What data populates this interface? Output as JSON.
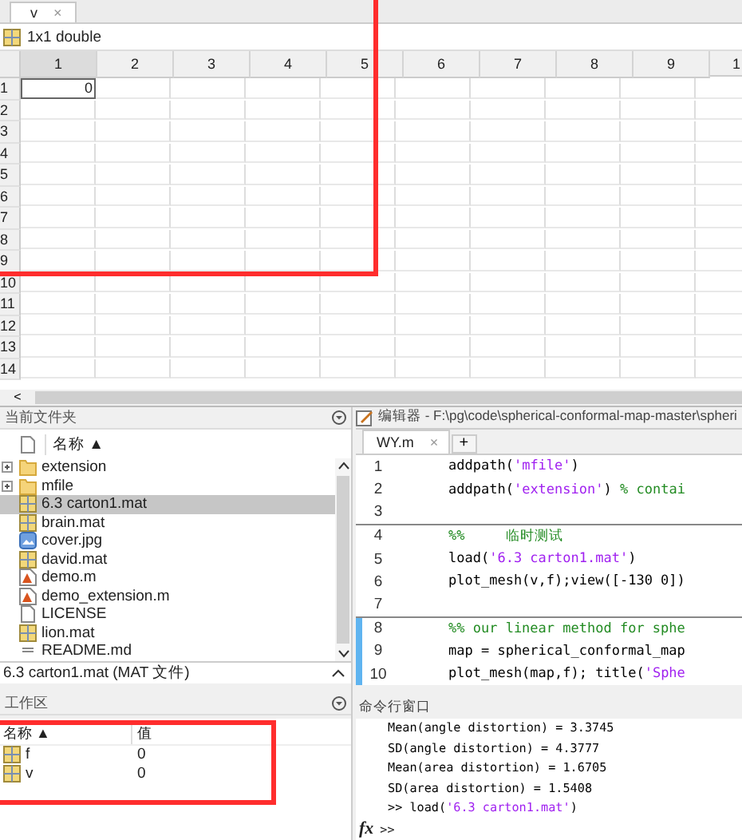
{
  "variable_editor": {
    "tab": {
      "label": "v",
      "close": "×",
      "selected": true
    },
    "info": "1x1 double",
    "columns": [
      "1",
      "2",
      "3",
      "4",
      "5",
      "6",
      "7",
      "8",
      "9",
      "1"
    ],
    "rows": [
      {
        "label": "1",
        "cells": [
          "0"
        ]
      },
      {
        "label": "2",
        "cells": []
      },
      {
        "label": "3",
        "cells": []
      },
      {
        "label": "4",
        "cells": []
      },
      {
        "label": "5",
        "cells": []
      },
      {
        "label": "6",
        "cells": []
      },
      {
        "label": "7",
        "cells": []
      },
      {
        "label": "8",
        "cells": []
      },
      {
        "label": "9",
        "cells": []
      },
      {
        "label": "10",
        "cells": []
      },
      {
        "label": "11",
        "cells": []
      },
      {
        "label": "12",
        "cells": []
      },
      {
        "label": "13",
        "cells": []
      },
      {
        "label": "14",
        "cells": []
      }
    ],
    "scroll_left": "<"
  },
  "current_folder": {
    "title": "当前文件夹",
    "column": "名称 ▲",
    "items": [
      {
        "name": "extension",
        "kind": "folder",
        "expandable": true,
        "selected": false
      },
      {
        "name": "mfile",
        "kind": "folder",
        "expandable": true,
        "selected": false
      },
      {
        "name": "6.3 carton1.mat",
        "kind": "mat",
        "expandable": false,
        "selected": true
      },
      {
        "name": "brain.mat",
        "kind": "mat",
        "expandable": false,
        "selected": false
      },
      {
        "name": "cover.jpg",
        "kind": "image",
        "expandable": false,
        "selected": false
      },
      {
        "name": "david.mat",
        "kind": "mat",
        "expandable": false,
        "selected": false
      },
      {
        "name": "demo.m",
        "kind": "script",
        "expandable": false,
        "selected": false
      },
      {
        "name": "demo_extension.m",
        "kind": "script",
        "expandable": false,
        "selected": false
      },
      {
        "name": "LICENSE",
        "kind": "file",
        "expandable": false,
        "selected": false
      },
      {
        "name": "lion.mat",
        "kind": "mat",
        "expandable": false,
        "selected": false
      },
      {
        "name": "README.md",
        "kind": "text",
        "expandable": false,
        "selected": false
      }
    ],
    "status": "6.3 carton1.mat  (MAT 文件)"
  },
  "workspace": {
    "title": "工作区",
    "columns": [
      "名称 ▲",
      "值"
    ],
    "variables": [
      {
        "name": "f",
        "value": "0"
      },
      {
        "name": "v",
        "value": "0"
      }
    ]
  },
  "editor": {
    "title": "编辑器 - F:\\pg\\code\\spherical-conformal-map-master\\spheri",
    "tab": {
      "label": "WY.m",
      "close": "×",
      "selected": true
    },
    "new_tab": "+",
    "lines": [
      {
        "number": "1",
        "section_start": false,
        "highlighted": false,
        "parts": [
          {
            "kind": "code",
            "text": "addpath("
          },
          {
            "kind": "string",
            "text": "'mfile'"
          },
          {
            "kind": "code",
            "text": ")"
          }
        ]
      },
      {
        "number": "2",
        "section_start": false,
        "highlighted": false,
        "parts": [
          {
            "kind": "code",
            "text": "addpath("
          },
          {
            "kind": "string",
            "text": "'extension'"
          },
          {
            "kind": "code",
            "text": ") "
          },
          {
            "kind": "comment",
            "text": "% contai"
          }
        ]
      },
      {
        "number": "3",
        "section_start": false,
        "highlighted": false
      },
      {
        "number": "4",
        "section_start": true,
        "highlighted": false,
        "parts": [
          {
            "kind": "comment",
            "text": "%%"
          },
          {
            "kind": "comment",
            "text": "     临时测试"
          }
        ]
      },
      {
        "number": "5",
        "section_start": false,
        "highlighted": false,
        "parts": [
          {
            "kind": "code",
            "text": "load("
          },
          {
            "kind": "string",
            "text": "'6.3 carton1.mat'"
          },
          {
            "kind": "code",
            "text": ")"
          }
        ]
      },
      {
        "number": "6",
        "section_start": false,
        "highlighted": false,
        "parts": [
          {
            "kind": "code",
            "text": "plot_mesh(v,f);view([-130 0])"
          }
        ]
      },
      {
        "number": "7",
        "section_start": false,
        "highlighted": false
      },
      {
        "number": "8",
        "section_start": true,
        "highlighted": true,
        "parts": [
          {
            "kind": "comment",
            "text": "%% our linear method for sphe"
          }
        ]
      },
      {
        "number": "9",
        "section_start": false,
        "highlighted": true,
        "parts": [
          {
            "kind": "code",
            "text": "map = spherical_conformal_map"
          }
        ]
      },
      {
        "number": "10",
        "section_start": false,
        "highlighted": true,
        "parts": [
          {
            "kind": "code",
            "text": "plot_mesh(map,f); title("
          },
          {
            "kind": "string",
            "text": "'Sphe"
          }
        ]
      }
    ]
  },
  "command_window": {
    "title": "命令行窗口",
    "lines": [
      {
        "parts": [
          {
            "kind": "code",
            "text": "Mean(angle distortion) = 3.3745"
          }
        ]
      },
      {
        "parts": [
          {
            "kind": "code",
            "text": "SD(angle distortion) = 4.3777"
          }
        ]
      },
      {
        "parts": [
          {
            "kind": "code",
            "text": "Mean(area distortion) = 1.6705"
          }
        ]
      },
      {
        "parts": [
          {
            "kind": "code",
            "text": "SD(area distortion) = 1.5408"
          }
        ]
      },
      {
        "parts": [
          {
            "kind": "code",
            "text": ">> load("
          },
          {
            "kind": "string",
            "text": "'6.3 carton1.mat'"
          },
          {
            "kind": "code",
            "text": ")"
          }
        ]
      }
    ],
    "fx": "fx",
    "prompt": ">>"
  }
}
